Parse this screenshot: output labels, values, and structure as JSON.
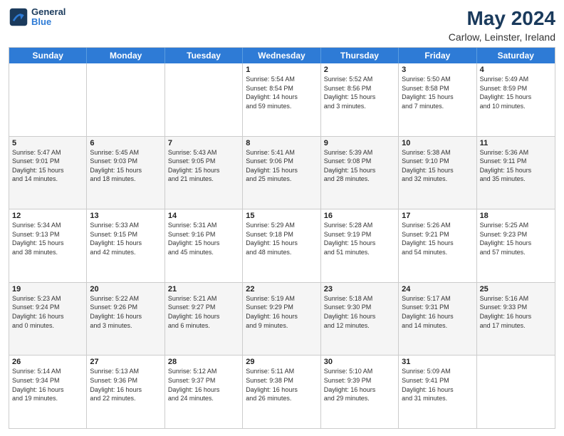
{
  "header": {
    "logo_line1": "General",
    "logo_line2": "Blue",
    "main_title": "May 2024",
    "subtitle": "Carlow, Leinster, Ireland"
  },
  "days_of_week": [
    "Sunday",
    "Monday",
    "Tuesday",
    "Wednesday",
    "Thursday",
    "Friday",
    "Saturday"
  ],
  "rows": [
    {
      "alt": false,
      "cells": [
        {
          "empty": true
        },
        {
          "empty": true
        },
        {
          "empty": true
        },
        {
          "day": "1",
          "lines": [
            "Sunrise: 5:54 AM",
            "Sunset: 8:54 PM",
            "Daylight: 14 hours",
            "and 59 minutes."
          ]
        },
        {
          "day": "2",
          "lines": [
            "Sunrise: 5:52 AM",
            "Sunset: 8:56 PM",
            "Daylight: 15 hours",
            "and 3 minutes."
          ]
        },
        {
          "day": "3",
          "lines": [
            "Sunrise: 5:50 AM",
            "Sunset: 8:58 PM",
            "Daylight: 15 hours",
            "and 7 minutes."
          ]
        },
        {
          "day": "4",
          "lines": [
            "Sunrise: 5:49 AM",
            "Sunset: 8:59 PM",
            "Daylight: 15 hours",
            "and 10 minutes."
          ]
        }
      ]
    },
    {
      "alt": true,
      "cells": [
        {
          "day": "5",
          "lines": [
            "Sunrise: 5:47 AM",
            "Sunset: 9:01 PM",
            "Daylight: 15 hours",
            "and 14 minutes."
          ]
        },
        {
          "day": "6",
          "lines": [
            "Sunrise: 5:45 AM",
            "Sunset: 9:03 PM",
            "Daylight: 15 hours",
            "and 18 minutes."
          ]
        },
        {
          "day": "7",
          "lines": [
            "Sunrise: 5:43 AM",
            "Sunset: 9:05 PM",
            "Daylight: 15 hours",
            "and 21 minutes."
          ]
        },
        {
          "day": "8",
          "lines": [
            "Sunrise: 5:41 AM",
            "Sunset: 9:06 PM",
            "Daylight: 15 hours",
            "and 25 minutes."
          ]
        },
        {
          "day": "9",
          "lines": [
            "Sunrise: 5:39 AM",
            "Sunset: 9:08 PM",
            "Daylight: 15 hours",
            "and 28 minutes."
          ]
        },
        {
          "day": "10",
          "lines": [
            "Sunrise: 5:38 AM",
            "Sunset: 9:10 PM",
            "Daylight: 15 hours",
            "and 32 minutes."
          ]
        },
        {
          "day": "11",
          "lines": [
            "Sunrise: 5:36 AM",
            "Sunset: 9:11 PM",
            "Daylight: 15 hours",
            "and 35 minutes."
          ]
        }
      ]
    },
    {
      "alt": false,
      "cells": [
        {
          "day": "12",
          "lines": [
            "Sunrise: 5:34 AM",
            "Sunset: 9:13 PM",
            "Daylight: 15 hours",
            "and 38 minutes."
          ]
        },
        {
          "day": "13",
          "lines": [
            "Sunrise: 5:33 AM",
            "Sunset: 9:15 PM",
            "Daylight: 15 hours",
            "and 42 minutes."
          ]
        },
        {
          "day": "14",
          "lines": [
            "Sunrise: 5:31 AM",
            "Sunset: 9:16 PM",
            "Daylight: 15 hours",
            "and 45 minutes."
          ]
        },
        {
          "day": "15",
          "lines": [
            "Sunrise: 5:29 AM",
            "Sunset: 9:18 PM",
            "Daylight: 15 hours",
            "and 48 minutes."
          ]
        },
        {
          "day": "16",
          "lines": [
            "Sunrise: 5:28 AM",
            "Sunset: 9:19 PM",
            "Daylight: 15 hours",
            "and 51 minutes."
          ]
        },
        {
          "day": "17",
          "lines": [
            "Sunrise: 5:26 AM",
            "Sunset: 9:21 PM",
            "Daylight: 15 hours",
            "and 54 minutes."
          ]
        },
        {
          "day": "18",
          "lines": [
            "Sunrise: 5:25 AM",
            "Sunset: 9:23 PM",
            "Daylight: 15 hours",
            "and 57 minutes."
          ]
        }
      ]
    },
    {
      "alt": true,
      "cells": [
        {
          "day": "19",
          "lines": [
            "Sunrise: 5:23 AM",
            "Sunset: 9:24 PM",
            "Daylight: 16 hours",
            "and 0 minutes."
          ]
        },
        {
          "day": "20",
          "lines": [
            "Sunrise: 5:22 AM",
            "Sunset: 9:26 PM",
            "Daylight: 16 hours",
            "and 3 minutes."
          ]
        },
        {
          "day": "21",
          "lines": [
            "Sunrise: 5:21 AM",
            "Sunset: 9:27 PM",
            "Daylight: 16 hours",
            "and 6 minutes."
          ]
        },
        {
          "day": "22",
          "lines": [
            "Sunrise: 5:19 AM",
            "Sunset: 9:29 PM",
            "Daylight: 16 hours",
            "and 9 minutes."
          ]
        },
        {
          "day": "23",
          "lines": [
            "Sunrise: 5:18 AM",
            "Sunset: 9:30 PM",
            "Daylight: 16 hours",
            "and 12 minutes."
          ]
        },
        {
          "day": "24",
          "lines": [
            "Sunrise: 5:17 AM",
            "Sunset: 9:31 PM",
            "Daylight: 16 hours",
            "and 14 minutes."
          ]
        },
        {
          "day": "25",
          "lines": [
            "Sunrise: 5:16 AM",
            "Sunset: 9:33 PM",
            "Daylight: 16 hours",
            "and 17 minutes."
          ]
        }
      ]
    },
    {
      "alt": false,
      "cells": [
        {
          "day": "26",
          "lines": [
            "Sunrise: 5:14 AM",
            "Sunset: 9:34 PM",
            "Daylight: 16 hours",
            "and 19 minutes."
          ]
        },
        {
          "day": "27",
          "lines": [
            "Sunrise: 5:13 AM",
            "Sunset: 9:36 PM",
            "Daylight: 16 hours",
            "and 22 minutes."
          ]
        },
        {
          "day": "28",
          "lines": [
            "Sunrise: 5:12 AM",
            "Sunset: 9:37 PM",
            "Daylight: 16 hours",
            "and 24 minutes."
          ]
        },
        {
          "day": "29",
          "lines": [
            "Sunrise: 5:11 AM",
            "Sunset: 9:38 PM",
            "Daylight: 16 hours",
            "and 26 minutes."
          ]
        },
        {
          "day": "30",
          "lines": [
            "Sunrise: 5:10 AM",
            "Sunset: 9:39 PM",
            "Daylight: 16 hours",
            "and 29 minutes."
          ]
        },
        {
          "day": "31",
          "lines": [
            "Sunrise: 5:09 AM",
            "Sunset: 9:41 PM",
            "Daylight: 16 hours",
            "and 31 minutes."
          ]
        },
        {
          "empty": true
        }
      ]
    }
  ]
}
